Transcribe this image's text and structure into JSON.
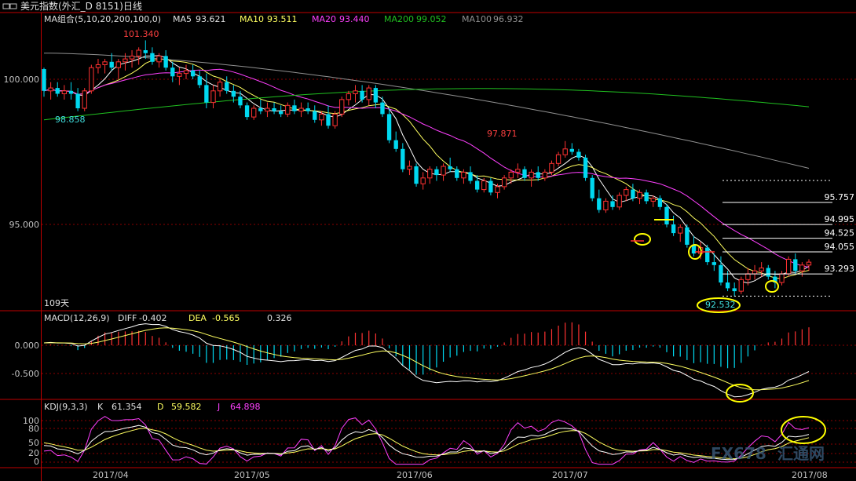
{
  "window": {
    "title": "美元指数(外汇_D 8151)日线",
    "menu_icon": "double-rectangle-icon"
  },
  "colors": {
    "background": "#000000",
    "frame": "#c00000",
    "grid": "#8b0000",
    "axis_text": "#c0c0c0",
    "up": "#ff3232",
    "down": "#00d8f0",
    "ma5": "#ffffff",
    "ma10": "#ffff60",
    "ma20": "#ff40ff",
    "ma200": "#20c020",
    "ma100": "#909090",
    "annotation": "#ffff00",
    "watermark": "#4a6a8a"
  },
  "price_panel": {
    "indicator_title": "MA组合(5,10,20,200,100,0)",
    "legend": [
      {
        "label": "MA5",
        "value": "93.621",
        "color": "#e0e0e0"
      },
      {
        "label": "MA10",
        "value": "93.511",
        "color": "#ffff60"
      },
      {
        "label": "MA20",
        "value": "93.440",
        "color": "#ff40ff"
      },
      {
        "label": "MA200",
        "value": "99.052",
        "color": "#20c020"
      },
      {
        "label": "MA100",
        "value": "96.932",
        "color": "#909090"
      }
    ],
    "y_labels": [
      "100.000",
      "95.000"
    ],
    "bar_count_label": "109天",
    "annotations": {
      "high": "101.340",
      "low_left": "98.858",
      "peak_mid": "97.871",
      "low_right": "92.532",
      "fib_levels": [
        "95.757",
        "94.995",
        "94.525",
        "94.055",
        "93.293"
      ]
    }
  },
  "macd_panel": {
    "title": "MACD(12,26,9)",
    "diff_label": "DIFF",
    "diff_value": "-0.402",
    "dea_label": "DEA",
    "dea_value": "-0.565",
    "macd_value": "0.326",
    "y_labels": [
      "0.000",
      "-0.500"
    ]
  },
  "kdj_panel": {
    "title": "KDJ(9,3,3)",
    "k_label": "K",
    "k_value": "61.354",
    "d_label": "D",
    "d_value": "59.582",
    "j_label": "J",
    "j_value": "64.898",
    "y_labels": [
      "100",
      "80",
      "50",
      "20",
      "0"
    ]
  },
  "x_axis": {
    "labels": [
      "2017/04",
      "2017/05",
      "2017/06",
      "2017/07",
      "2017/08"
    ]
  },
  "watermark": {
    "text": "FX678",
    "text2": "汇通网"
  },
  "chart_data": {
    "type": "candlestick",
    "title": "美元指数(外汇_D 8151)日线",
    "x_labels": [
      "2017/04",
      "2017/05",
      "2017/06",
      "2017/07",
      "2017/08"
    ],
    "price_range": [
      92.2,
      102.1
    ],
    "candles_ohlc": [
      [
        100.35,
        100.4,
        99.4,
        99.6
      ],
      [
        99.6,
        99.9,
        99.3,
        99.7
      ],
      [
        99.7,
        99.9,
        99.4,
        99.5
      ],
      [
        99.5,
        99.8,
        99.3,
        99.6
      ],
      [
        99.6,
        99.9,
        99.3,
        99.5
      ],
      [
        99.5,
        99.7,
        98.9,
        99.0
      ],
      [
        99.0,
        99.7,
        98.9,
        99.6
      ],
      [
        99.6,
        100.5,
        99.5,
        100.4
      ],
      [
        100.4,
        100.7,
        100.2,
        100.5
      ],
      [
        100.5,
        100.7,
        100.2,
        100.6
      ],
      [
        100.6,
        100.9,
        100.3,
        100.4
      ],
      [
        100.4,
        100.7,
        100.0,
        100.6
      ],
      [
        100.6,
        100.9,
        100.3,
        100.7
      ],
      [
        100.7,
        101.0,
        100.4,
        100.8
      ],
      [
        100.8,
        101.1,
        100.5,
        101.0
      ],
      [
        101.0,
        101.34,
        100.7,
        100.9
      ],
      [
        100.9,
        101.1,
        100.5,
        100.6
      ],
      [
        100.6,
        100.9,
        100.4,
        100.8
      ],
      [
        100.8,
        101.0,
        100.3,
        100.4
      ],
      [
        100.4,
        100.6,
        99.9,
        100.1
      ],
      [
        100.1,
        100.4,
        99.8,
        100.2
      ],
      [
        100.2,
        100.5,
        100.0,
        100.3
      ],
      [
        100.3,
        100.5,
        100.0,
        100.1
      ],
      [
        100.1,
        100.3,
        99.7,
        99.8
      ],
      [
        99.8,
        100.2,
        99.0,
        99.2
      ],
      [
        99.2,
        99.8,
        99.0,
        99.6
      ],
      [
        99.6,
        100.0,
        99.4,
        99.9
      ],
      [
        99.9,
        100.1,
        99.5,
        99.6
      ],
      [
        99.6,
        99.8,
        99.2,
        99.4
      ],
      [
        99.4,
        99.6,
        99.0,
        99.1
      ],
      [
        99.1,
        99.2,
        98.6,
        98.7
      ],
      [
        98.7,
        99.1,
        98.6,
        99.0
      ],
      [
        99.0,
        99.3,
        98.8,
        98.9
      ],
      [
        98.9,
        99.2,
        98.7,
        99.0
      ],
      [
        99.0,
        99.2,
        98.8,
        98.9
      ],
      [
        98.9,
        99.1,
        98.7,
        98.8
      ],
      [
        98.8,
        99.2,
        98.7,
        99.1
      ],
      [
        99.1,
        99.3,
        98.8,
        98.9
      ],
      [
        98.9,
        99.2,
        98.7,
        99.0
      ],
      [
        99.0,
        99.2,
        98.8,
        98.9
      ],
      [
        98.9,
        99.1,
        98.5,
        98.6
      ],
      [
        98.6,
        98.9,
        98.4,
        98.8
      ],
      [
        98.8,
        99.1,
        98.3,
        98.4
      ],
      [
        98.4,
        98.9,
        98.3,
        98.8
      ],
      [
        98.8,
        99.4,
        98.7,
        99.3
      ],
      [
        99.3,
        99.6,
        99.1,
        99.5
      ],
      [
        99.5,
        99.8,
        99.2,
        99.6
      ],
      [
        99.6,
        99.8,
        99.2,
        99.3
      ],
      [
        99.3,
        99.8,
        99.1,
        99.7
      ],
      [
        99.7,
        99.8,
        99.0,
        99.2
      ],
      [
        99.2,
        99.4,
        98.7,
        98.8
      ],
      [
        98.8,
        99.0,
        97.8,
        97.9
      ],
      [
        97.9,
        98.2,
        97.5,
        97.6
      ],
      [
        97.6,
        97.8,
        96.8,
        96.9
      ],
      [
        96.9,
        97.2,
        96.7,
        97.0
      ],
      [
        97.0,
        97.1,
        96.3,
        96.4
      ],
      [
        96.4,
        96.8,
        96.2,
        96.6
      ],
      [
        96.6,
        97.0,
        96.4,
        96.9
      ],
      [
        96.9,
        97.0,
        96.5,
        96.7
      ],
      [
        96.7,
        97.1,
        96.5,
        97.0
      ],
      [
        97.0,
        97.3,
        96.8,
        96.9
      ],
      [
        96.9,
        97.0,
        96.5,
        96.6
      ],
      [
        96.6,
        96.9,
        96.4,
        96.8
      ],
      [
        96.8,
        97.0,
        96.4,
        96.5
      ],
      [
        96.5,
        96.7,
        96.1,
        96.2
      ],
      [
        96.2,
        96.6,
        96.1,
        96.5
      ],
      [
        96.5,
        96.6,
        96.0,
        96.1
      ],
      [
        96.1,
        96.4,
        95.9,
        96.3
      ],
      [
        96.3,
        96.7,
        96.2,
        96.6
      ],
      [
        96.6,
        96.9,
        96.4,
        96.8
      ],
      [
        96.8,
        97.1,
        96.6,
        96.9
      ],
      [
        96.9,
        97.0,
        96.5,
        96.6
      ],
      [
        96.6,
        96.9,
        96.3,
        96.8
      ],
      [
        96.8,
        97.0,
        96.5,
        96.6
      ],
      [
        96.6,
        96.9,
        96.5,
        96.8
      ],
      [
        96.8,
        97.2,
        96.7,
        97.1
      ],
      [
        97.1,
        97.5,
        97.0,
        97.4
      ],
      [
        97.4,
        97.871,
        97.3,
        97.6
      ],
      [
        97.6,
        97.8,
        97.4,
        97.5
      ],
      [
        97.5,
        97.6,
        97.2,
        97.3
      ],
      [
        97.3,
        97.4,
        96.5,
        96.6
      ],
      [
        96.6,
        96.7,
        95.8,
        95.9
      ],
      [
        95.9,
        96.2,
        95.4,
        95.5
      ],
      [
        95.5,
        95.9,
        95.4,
        95.8
      ],
      [
        95.8,
        96.0,
        95.5,
        95.6
      ],
      [
        95.6,
        96.1,
        95.5,
        96.0
      ],
      [
        96.0,
        96.3,
        95.8,
        96.2
      ],
      [
        96.2,
        96.4,
        95.8,
        95.9
      ],
      [
        95.9,
        96.2,
        95.7,
        96.1
      ],
      [
        96.1,
        96.2,
        95.7,
        95.8
      ],
      [
        95.8,
        96.0,
        95.6,
        95.9
      ],
      [
        95.9,
        96.0,
        95.5,
        95.6
      ],
      [
        95.6,
        95.7,
        94.9,
        95.0
      ],
      [
        95.0,
        95.3,
        94.6,
        94.7
      ],
      [
        94.7,
        95.0,
        94.4,
        94.9
      ],
      [
        94.9,
        95.0,
        94.2,
        94.3
      ],
      [
        94.3,
        94.6,
        93.9,
        94.0
      ],
      [
        94.0,
        94.4,
        93.8,
        94.2
      ],
      [
        94.2,
        94.3,
        93.6,
        93.7
      ],
      [
        93.7,
        94.0,
        93.4,
        93.6
      ],
      [
        93.6,
        93.9,
        92.9,
        93.0
      ],
      [
        93.0,
        93.4,
        92.7,
        92.8
      ],
      [
        92.8,
        93.0,
        92.532,
        92.7
      ],
      [
        92.7,
        93.2,
        92.6,
        93.1
      ],
      [
        93.1,
        93.5,
        92.9,
        93.3
      ],
      [
        93.3,
        93.6,
        93.1,
        93.4
      ],
      [
        93.4,
        93.7,
        93.2,
        93.5
      ],
      [
        93.5,
        93.6,
        93.1,
        93.2
      ],
      [
        93.2,
        93.4,
        92.8,
        93.0
      ],
      [
        93.0,
        93.4,
        92.9,
        93.3
      ],
      [
        93.3,
        93.9,
        93.2,
        93.8
      ],
      [
        93.8,
        94.0,
        93.3,
        93.4
      ],
      [
        93.4,
        93.7,
        93.2,
        93.6
      ],
      [
        93.6,
        93.8,
        93.4,
        93.7
      ]
    ],
    "ma_last_values": {
      "MA5": 93.621,
      "MA10": 93.511,
      "MA20": 93.44,
      "MA200": 99.052,
      "MA100": 96.932
    },
    "fib_levels": [
      95.757,
      94.995,
      94.525,
      94.055,
      93.293
    ],
    "macd": {
      "diff": -0.402,
      "dea": -0.565,
      "macd": 0.326,
      "y_range": [
        -0.85,
        0.4
      ]
    },
    "kdj": {
      "k": 61.354,
      "d": 59.582,
      "j": 64.898,
      "y_range": [
        -10,
        115
      ]
    }
  }
}
